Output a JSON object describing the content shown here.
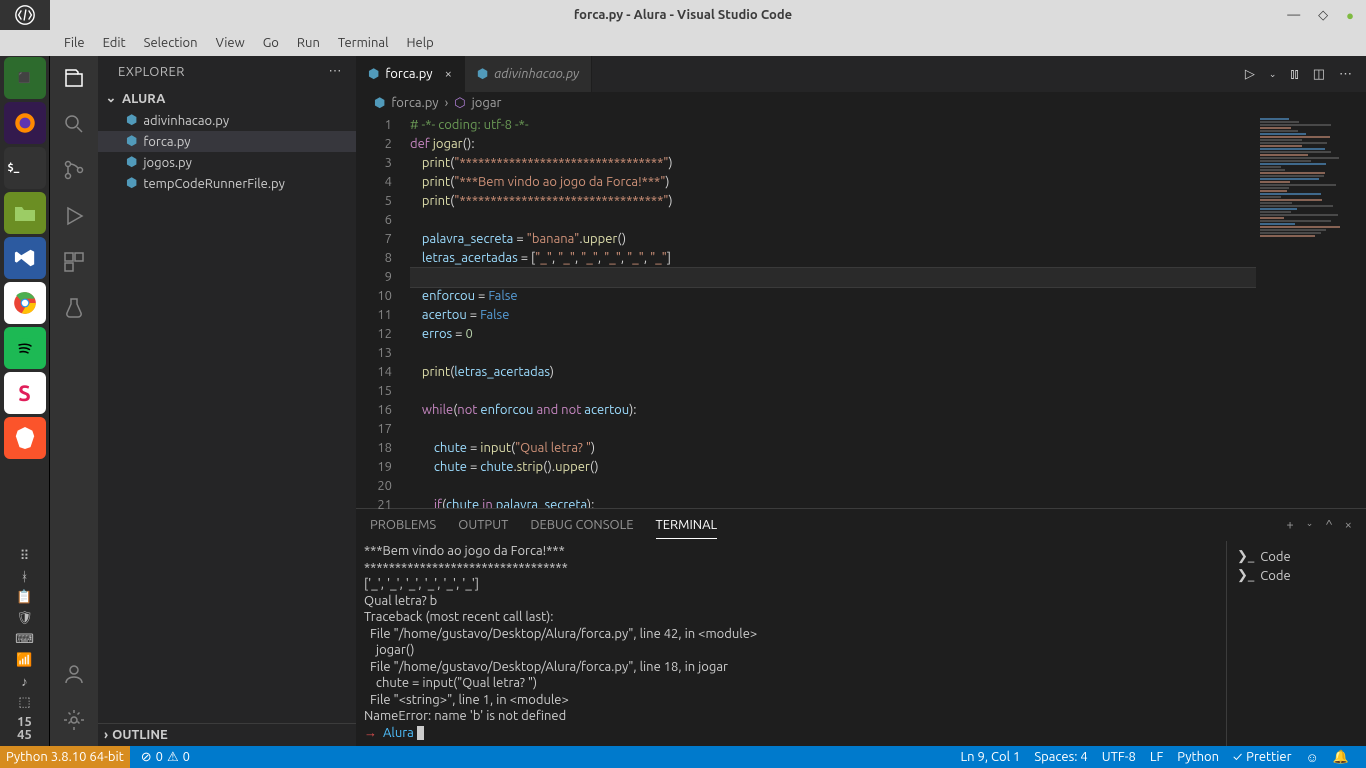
{
  "window": {
    "title": "forca.py - Alura - Visual Studio Code"
  },
  "menus": [
    "File",
    "Edit",
    "Selection",
    "View",
    "Go",
    "Run",
    "Terminal",
    "Help"
  ],
  "os_dock": {
    "clock_line1": "15",
    "clock_line2": "45"
  },
  "sidebar": {
    "title": "EXPLORER",
    "project": "ALURA",
    "files": [
      {
        "name": "adivinhacao.py",
        "active": false
      },
      {
        "name": "forca.py",
        "active": true
      },
      {
        "name": "jogos.py",
        "active": false
      },
      {
        "name": "tempCodeRunnerFile.py",
        "active": false
      }
    ],
    "outline": "OUTLINE"
  },
  "tabs": [
    {
      "name": "forca.py",
      "active": true,
      "close": "×"
    },
    {
      "name": "adivinhacao.py",
      "active": false,
      "close": ""
    }
  ],
  "breadcrumb": {
    "file": "forca.py",
    "symbol": "jogar"
  },
  "editor": {
    "line_start": 1,
    "highlighted_line": 9,
    "lines": [
      {
        "t": "comment",
        "text": "# -*- coding: utf-8 -*-"
      },
      {
        "t": "def",
        "text": "def jogar():"
      },
      {
        "t": "print",
        "arg": "\"*********************************\""
      },
      {
        "t": "print",
        "arg": "\"***Bem vindo ao jogo da Forca!***\""
      },
      {
        "t": "print",
        "arg": "\"*********************************\""
      },
      {
        "t": "blank"
      },
      {
        "t": "assign_upper",
        "var": "palavra_secreta",
        "str": "\"banana\""
      },
      {
        "t": "list",
        "var": "letras_acertadas",
        "items": [
          "\"_\"",
          "\"_\"",
          "\"_\"",
          "\"_\"",
          "\"_\"",
          "\"_\""
        ]
      },
      {
        "t": "blank",
        "hl": true
      },
      {
        "t": "assign_bool",
        "var": "enforcou",
        "val": "False"
      },
      {
        "t": "assign_bool",
        "var": "acertou",
        "val": "False"
      },
      {
        "t": "assign_num",
        "var": "erros",
        "val": "0"
      },
      {
        "t": "blank"
      },
      {
        "t": "print_var",
        "arg": "letras_acertadas"
      },
      {
        "t": "blank"
      },
      {
        "t": "while"
      },
      {
        "t": "blank"
      },
      {
        "t": "input",
        "var": "chute",
        "str": "\"Qual letra? \""
      },
      {
        "t": "strip",
        "var": "chute"
      },
      {
        "t": "blank"
      },
      {
        "t": "if_in"
      }
    ]
  },
  "panel": {
    "tabs": [
      "PROBLEMS",
      "OUTPUT",
      "DEBUG CONSOLE",
      "TERMINAL"
    ],
    "active": 3,
    "terminal_items": [
      "Code",
      "Code"
    ],
    "terminal_lines": [
      "***Bem vindo ao jogo da Forca!***",
      "*********************************",
      "['_', '_', '_', '_', '_', '_']",
      "Qual letra? b",
      "Traceback (most recent call last):",
      "  File \"/home/gustavo/Desktop/Alura/forca.py\", line 42, in <module>",
      "    jogar()",
      "  File \"/home/gustavo/Desktop/Alura/forca.py\", line 18, in jogar",
      "    chute = input(\"Qual letra? \")",
      "  File \"<string>\", line 1, in <module>",
      "NameError: name 'b' is not defined"
    ],
    "prompt": {
      "arrow": "→",
      "dir": "Alura"
    }
  },
  "status": {
    "python": "Python 3.8.10 64-bit",
    "errors": "0",
    "warnings": "0",
    "pos": "Ln 9, Col 1",
    "spaces": "Spaces: 4",
    "enc": "UTF-8",
    "eol": "LF",
    "lang": "Python",
    "prettier": "Prettier"
  }
}
